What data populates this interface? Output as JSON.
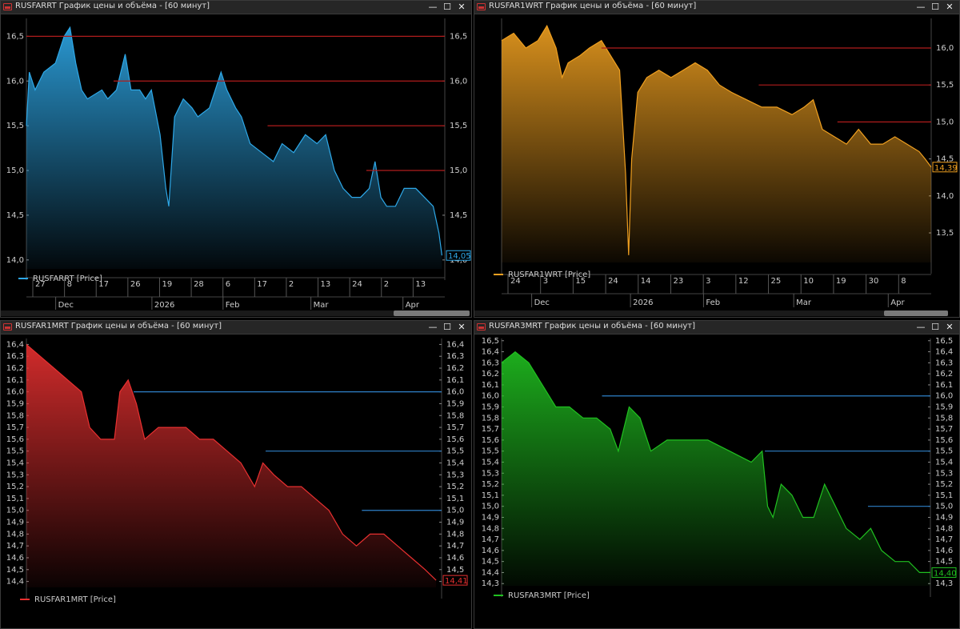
{
  "window_controls": {
    "minimize": "—",
    "maximize": "☐",
    "close": "✕"
  },
  "panels": [
    {
      "title": "RUSFARRT График цены и объёма - [60 минут]",
      "legend": "RUSFARRT [Price]",
      "last_value": "14,05",
      "color": "#2ea8e8",
      "ref_color": "#b01c1c",
      "yticks": [
        "16,5",
        "16,0",
        "15,5",
        "15,0",
        "14,5",
        "14,0"
      ],
      "xticks_top": [
        "27",
        "8",
        "17",
        "26",
        "19",
        "28",
        "6",
        "17",
        "2",
        "13",
        "24",
        "2",
        "13"
      ],
      "xticks_bottom": [
        "Dec",
        "2026",
        "Feb",
        "Mar",
        "Apr"
      ],
      "chart_data": {
        "type": "area",
        "y_range": [
          13.9,
          16.7
        ],
        "x_range": [
          "2025-11-21",
          "2026-04-14"
        ],
        "points": [
          [
            "2025-11-21",
            15.5
          ],
          [
            "2025-11-22",
            16.1
          ],
          [
            "2025-11-24",
            15.9
          ],
          [
            "2025-11-27",
            16.1
          ],
          [
            "2025-12-01",
            16.2
          ],
          [
            "2025-12-04",
            16.5
          ],
          [
            "2025-12-06",
            16.6
          ],
          [
            "2025-12-08",
            16.2
          ],
          [
            "2025-12-10",
            15.9
          ],
          [
            "2025-12-12",
            15.8
          ],
          [
            "2025-12-17",
            15.9
          ],
          [
            "2025-12-19",
            15.8
          ],
          [
            "2025-12-22",
            15.9
          ],
          [
            "2025-12-25",
            16.3
          ],
          [
            "2025-12-27",
            15.9
          ],
          [
            "2025-12-30",
            15.9
          ],
          [
            "2026-01-01",
            15.8
          ],
          [
            "2026-01-03",
            15.9
          ],
          [
            "2026-01-06",
            15.4
          ],
          [
            "2026-01-08",
            14.8
          ],
          [
            "2026-01-09",
            14.6
          ],
          [
            "2026-01-11",
            15.6
          ],
          [
            "2026-01-14",
            15.8
          ],
          [
            "2026-01-17",
            15.7
          ],
          [
            "2026-01-19",
            15.6
          ],
          [
            "2026-01-23",
            15.7
          ],
          [
            "2026-01-25",
            15.9
          ],
          [
            "2026-01-27",
            16.1
          ],
          [
            "2026-01-29",
            15.9
          ],
          [
            "2026-02-01",
            15.7
          ],
          [
            "2026-02-03",
            15.6
          ],
          [
            "2026-02-06",
            15.3
          ],
          [
            "2026-02-10",
            15.2
          ],
          [
            "2026-02-14",
            15.1
          ],
          [
            "2026-02-17",
            15.3
          ],
          [
            "2026-02-21",
            15.2
          ],
          [
            "2026-02-25",
            15.4
          ],
          [
            "2026-03-01",
            15.3
          ],
          [
            "2026-03-04",
            15.4
          ],
          [
            "2026-03-07",
            15.0
          ],
          [
            "2026-03-10",
            14.8
          ],
          [
            "2026-03-13",
            14.7
          ],
          [
            "2026-03-16",
            14.7
          ],
          [
            "2026-03-19",
            14.8
          ],
          [
            "2026-03-21",
            15.1
          ],
          [
            "2026-03-23",
            14.7
          ],
          [
            "2026-03-25",
            14.6
          ],
          [
            "2026-03-28",
            14.6
          ],
          [
            "2026-03-31",
            14.8
          ],
          [
            "2026-04-04",
            14.8
          ],
          [
            "2026-04-07",
            14.7
          ],
          [
            "2026-04-10",
            14.6
          ],
          [
            "2026-04-12",
            14.3
          ],
          [
            "2026-04-13",
            14.05
          ]
        ],
        "reference_lines": [
          {
            "y": 16.5,
            "from": "2025-11-21"
          },
          {
            "y": 16.0,
            "from": "2025-12-21"
          },
          {
            "y": 15.5,
            "from": "2026-02-12"
          },
          {
            "y": 15.0,
            "from": "2026-03-18"
          }
        ]
      }
    },
    {
      "title": "RUSFAR1WRT График цены и объёма - [60 минут]",
      "legend": "RUSFAR1WRT [Price]",
      "last_value": "14,39",
      "color": "#f0a020",
      "ref_color": "#b01c1c",
      "yticks": [
        "16,0",
        "15,5",
        "15,0",
        "14,5",
        "14,0",
        "13,5"
      ],
      "xticks_top": [
        "24",
        "3",
        "15",
        "24",
        "14",
        "23",
        "3",
        "12",
        "25",
        "10",
        "19",
        "30",
        "8"
      ],
      "xticks_bottom": [
        "Dec",
        "2026",
        "Feb",
        "Mar",
        "Apr"
      ],
      "chart_data": {
        "type": "area",
        "y_range": [
          13.1,
          16.4
        ],
        "x_range": [
          "2025-11-21",
          "2026-04-12"
        ],
        "points": [
          [
            "2025-11-21",
            16.1
          ],
          [
            "2025-11-25",
            16.2
          ],
          [
            "2025-11-29",
            16.0
          ],
          [
            "2025-12-03",
            16.1
          ],
          [
            "2025-12-06",
            16.3
          ],
          [
            "2025-12-09",
            16.0
          ],
          [
            "2025-12-11",
            15.6
          ],
          [
            "2025-12-13",
            15.8
          ],
          [
            "2025-12-17",
            15.9
          ],
          [
            "2025-12-20",
            16.0
          ],
          [
            "2025-12-24",
            16.1
          ],
          [
            "2025-12-27",
            15.9
          ],
          [
            "2025-12-30",
            15.7
          ],
          [
            "2026-01-01",
            14.3
          ],
          [
            "2026-01-02",
            13.2
          ],
          [
            "2026-01-03",
            14.5
          ],
          [
            "2026-01-05",
            15.4
          ],
          [
            "2026-01-08",
            15.6
          ],
          [
            "2026-01-12",
            15.7
          ],
          [
            "2026-01-16",
            15.6
          ],
          [
            "2026-01-20",
            15.7
          ],
          [
            "2026-01-24",
            15.8
          ],
          [
            "2026-01-28",
            15.7
          ],
          [
            "2026-02-01",
            15.5
          ],
          [
            "2026-02-05",
            15.4
          ],
          [
            "2026-02-10",
            15.3
          ],
          [
            "2026-02-15",
            15.2
          ],
          [
            "2026-02-20",
            15.2
          ],
          [
            "2026-02-25",
            15.1
          ],
          [
            "2026-03-01",
            15.2
          ],
          [
            "2026-03-04",
            15.3
          ],
          [
            "2026-03-07",
            14.9
          ],
          [
            "2026-03-11",
            14.8
          ],
          [
            "2026-03-15",
            14.7
          ],
          [
            "2026-03-19",
            14.9
          ],
          [
            "2026-03-23",
            14.7
          ],
          [
            "2026-03-27",
            14.7
          ],
          [
            "2026-03-31",
            14.8
          ],
          [
            "2026-04-04",
            14.7
          ],
          [
            "2026-04-08",
            14.6
          ],
          [
            "2026-04-10",
            14.5
          ],
          [
            "2026-04-12",
            14.39
          ]
        ],
        "reference_lines": [
          {
            "y": 16.0,
            "from": "2025-12-24"
          },
          {
            "y": 15.5,
            "from": "2026-02-14"
          },
          {
            "y": 15.0,
            "from": "2026-03-12"
          }
        ]
      }
    },
    {
      "title": "RUSFAR1MRT График цены и объёма - [60 минут]",
      "legend": "RUSFAR1MRT [Price]",
      "last_value": "14,41",
      "color": "#e83030",
      "ref_color": "#2e80c8",
      "yticks": [
        "16,4",
        "16,3",
        "16,2",
        "16,1",
        "16,0",
        "15,9",
        "15,8",
        "15,7",
        "15,6",
        "15,5",
        "15,4",
        "15,3",
        "15,2",
        "15,1",
        "15,0",
        "14,9",
        "14,8",
        "14,7",
        "14,6",
        "14,5",
        "14,4"
      ],
      "xticks_top": [
        "21",
        "2",
        "15",
        "24",
        "16",
        "28",
        "6",
        "18",
        "2",
        "13",
        "24",
        "3",
        "15"
      ],
      "xticks_bottom": [
        "Dec",
        "2026",
        "Feb",
        "Mar",
        "Apr"
      ],
      "chart_data": {
        "type": "area",
        "y_range": [
          14.35,
          16.45
        ],
        "x_range": [
          "2025-11-15",
          "2026-04-15"
        ],
        "points": [
          [
            "2025-11-15",
            16.4
          ],
          [
            "2025-11-20",
            16.3
          ],
          [
            "2025-11-25",
            16.2
          ],
          [
            "2025-11-30",
            16.1
          ],
          [
            "2025-12-05",
            16.0
          ],
          [
            "2025-12-08",
            15.7
          ],
          [
            "2025-12-12",
            15.6
          ],
          [
            "2025-12-17",
            15.6
          ],
          [
            "2025-12-19",
            16.0
          ],
          [
            "2025-12-22",
            16.1
          ],
          [
            "2025-12-25",
            15.9
          ],
          [
            "2025-12-28",
            15.6
          ],
          [
            "2026-01-02",
            15.7
          ],
          [
            "2026-01-07",
            15.7
          ],
          [
            "2026-01-12",
            15.7
          ],
          [
            "2026-01-17",
            15.6
          ],
          [
            "2026-01-22",
            15.6
          ],
          [
            "2026-01-27",
            15.5
          ],
          [
            "2026-02-01",
            15.4
          ],
          [
            "2026-02-06",
            15.2
          ],
          [
            "2026-02-09",
            15.4
          ],
          [
            "2026-02-13",
            15.3
          ],
          [
            "2026-02-18",
            15.2
          ],
          [
            "2026-02-23",
            15.2
          ],
          [
            "2026-02-28",
            15.1
          ],
          [
            "2026-03-05",
            15.0
          ],
          [
            "2026-03-10",
            14.8
          ],
          [
            "2026-03-15",
            14.7
          ],
          [
            "2026-03-20",
            14.8
          ],
          [
            "2026-03-25",
            14.8
          ],
          [
            "2026-03-30",
            14.7
          ],
          [
            "2026-04-04",
            14.6
          ],
          [
            "2026-04-09",
            14.5
          ],
          [
            "2026-04-13",
            14.41
          ]
        ],
        "reference_lines": [
          {
            "y": 16.0,
            "from": "2025-12-24"
          },
          {
            "y": 15.5,
            "from": "2026-02-10"
          },
          {
            "y": 15.0,
            "from": "2026-03-17"
          }
        ]
      }
    },
    {
      "title": "RUSFAR3MRT График цены и объёма - [60 минут]",
      "legend": "RUSFAR3MRT [Price]",
      "last_value": "14,40",
      "color": "#20c020",
      "ref_color": "#2e80c8",
      "yticks": [
        "16,5",
        "16,4",
        "16,3",
        "16,2",
        "16,1",
        "16,0",
        "15,9",
        "15,8",
        "15,7",
        "15,6",
        "15,5",
        "15,4",
        "15,3",
        "15,2",
        "15,1",
        "15,0",
        "14,9",
        "14,8",
        "14,7",
        "14,6",
        "14,5",
        "14,4",
        "14,3"
      ],
      "xticks_top": [
        "14",
        "25",
        "5",
        "16",
        "26",
        "21",
        "2",
        "12",
        "25",
        "6",
        "19",
        "30",
        "8"
      ],
      "xticks_bottom": [
        "Dec",
        "2026",
        "Feb",
        "Mar",
        "Apr"
      ],
      "chart_data": {
        "type": "area",
        "y_range": [
          14.28,
          16.52
        ],
        "x_range": [
          "2025-11-05",
          "2026-04-12"
        ],
        "points": [
          [
            "2025-11-05",
            16.3
          ],
          [
            "2025-11-10",
            16.4
          ],
          [
            "2025-11-15",
            16.3
          ],
          [
            "2025-11-20",
            16.1
          ],
          [
            "2025-11-25",
            15.9
          ],
          [
            "2025-11-30",
            15.9
          ],
          [
            "2025-12-05",
            15.8
          ],
          [
            "2025-12-10",
            15.8
          ],
          [
            "2025-12-15",
            15.7
          ],
          [
            "2025-12-18",
            15.5
          ],
          [
            "2025-12-22",
            15.9
          ],
          [
            "2025-12-26",
            15.8
          ],
          [
            "2025-12-30",
            15.5
          ],
          [
            "2026-01-05",
            15.6
          ],
          [
            "2026-01-12",
            15.6
          ],
          [
            "2026-01-20",
            15.6
          ],
          [
            "2026-01-28",
            15.5
          ],
          [
            "2026-02-05",
            15.4
          ],
          [
            "2026-02-09",
            15.5
          ],
          [
            "2026-02-11",
            15.0
          ],
          [
            "2026-02-13",
            14.9
          ],
          [
            "2026-02-16",
            15.2
          ],
          [
            "2026-02-20",
            15.1
          ],
          [
            "2026-02-24",
            14.9
          ],
          [
            "2026-02-28",
            14.9
          ],
          [
            "2026-03-04",
            15.2
          ],
          [
            "2026-03-08",
            15.0
          ],
          [
            "2026-03-12",
            14.8
          ],
          [
            "2026-03-17",
            14.7
          ],
          [
            "2026-03-21",
            14.8
          ],
          [
            "2026-03-25",
            14.6
          ],
          [
            "2026-03-30",
            14.5
          ],
          [
            "2026-04-04",
            14.5
          ],
          [
            "2026-04-08",
            14.4
          ],
          [
            "2026-04-12",
            14.4
          ]
        ],
        "reference_lines": [
          {
            "y": 16.0,
            "from": "2025-12-12"
          },
          {
            "y": 15.5,
            "from": "2026-02-10"
          },
          {
            "y": 15.0,
            "from": "2026-03-20"
          }
        ]
      }
    }
  ]
}
